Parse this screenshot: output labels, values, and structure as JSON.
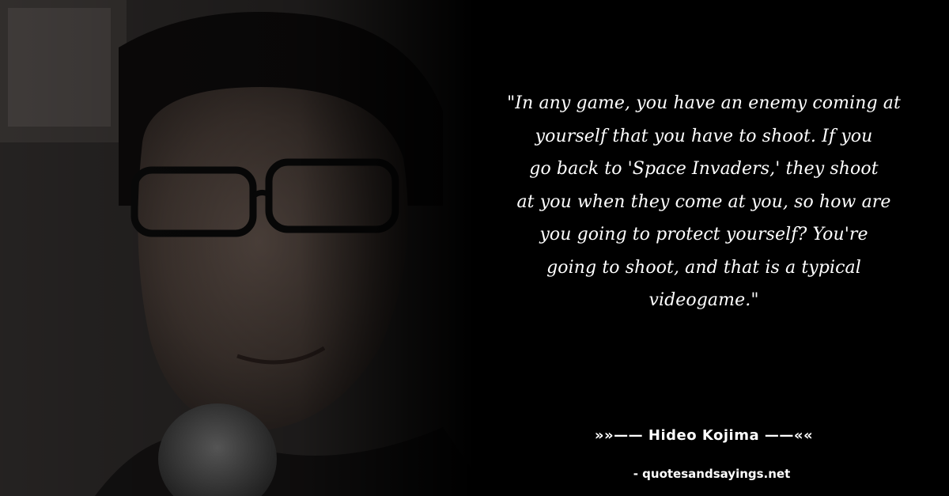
{
  "quote": {
    "lines": [
      "\"In any game, you have an enemy coming at",
      "yourself that you have to shoot. If you",
      "go back to 'Space Invaders,' they shoot",
      "at you when they come at you, so how are",
      "you going to protect yourself? You're",
      "going to shoot, and that is a typical",
      "videogame.\""
    ]
  },
  "author": "»»—— Hideo Kojima ——««",
  "source": "- quotesandsayings.net",
  "colors": {
    "background": "#000000",
    "text": "#ffffff"
  }
}
